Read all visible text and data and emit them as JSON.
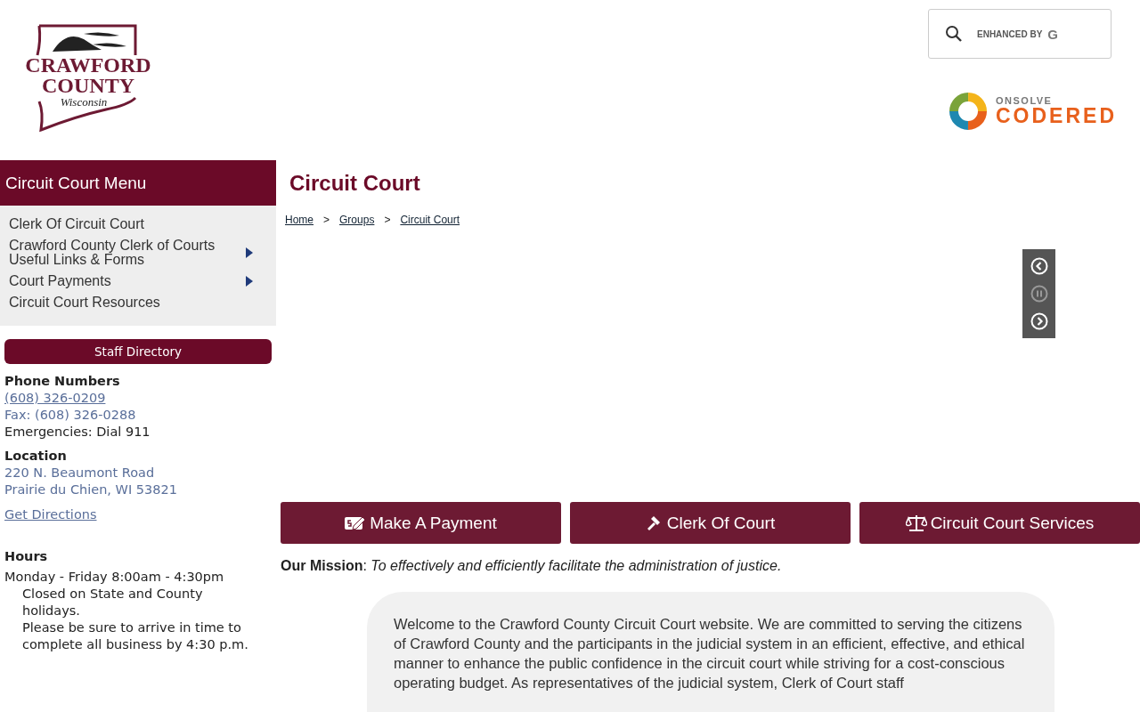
{
  "logo": {
    "line1": "CRAWFORD",
    "line2": "COUNTY",
    "line3": "Wisconsin"
  },
  "search": {
    "placeholder": "ENHANCED BY",
    "brand_mark": "G"
  },
  "alert_logo": {
    "small": "ONSOLVE",
    "large": "CODERED"
  },
  "sidebar": {
    "title": "Circuit Court Menu",
    "items": [
      {
        "label": "Clerk Of Circuit Court",
        "has_submenu": false
      },
      {
        "label": "Crawford County Clerk of Courts Useful Links & Forms",
        "has_submenu": true
      },
      {
        "label": "Court Payments",
        "has_submenu": true
      },
      {
        "label": "Circuit Court Resources",
        "has_submenu": false
      }
    ],
    "staff_button": "Staff Directory",
    "phone_heading": "Phone Numbers",
    "phone": "(608) 326-0209",
    "fax": "Fax: (608) 326-0288",
    "emergency": "Emergencies: Dial 911",
    "location_heading": "Location",
    "address": [
      "220 N. Beaumont Road",
      "Prairie du Chien, WI 53821"
    ],
    "directions": "Get Directions",
    "hours_heading": "Hours",
    "hours": "Monday - Friday 8:00am - 4:30pm",
    "hours_notes": [
      "Closed on State and County holidays.",
      "Please be sure to arrive in time to complete all business by 4:30 p.m."
    ]
  },
  "page_title": "Circuit Court",
  "breadcrumb": [
    "Home",
    "Groups",
    "Circuit Court"
  ],
  "breadcrumb_separator": ">",
  "slideshow": {
    "paused": false
  },
  "action_buttons": [
    {
      "kind": "payment",
      "label": "Make A Payment"
    },
    {
      "kind": "gavel",
      "label": "Clerk Of Court"
    },
    {
      "kind": "scales",
      "label": "Circuit Court Services"
    }
  ],
  "mission": "**Our Mission**:  *To effectively and efficiently facilitate the administration of justice.*",
  "welcome": "Welcome to the Crawford County Circuit Court website. We are committed to serving the citizens of Crawford County and the participants in the judicial system in an efficient, effective, and ethical manner to enhance the public confidence in the circuit court while striving for a cost-conscious operating budget.  As representatives of the judicial system, Clerk of Court staff"
}
